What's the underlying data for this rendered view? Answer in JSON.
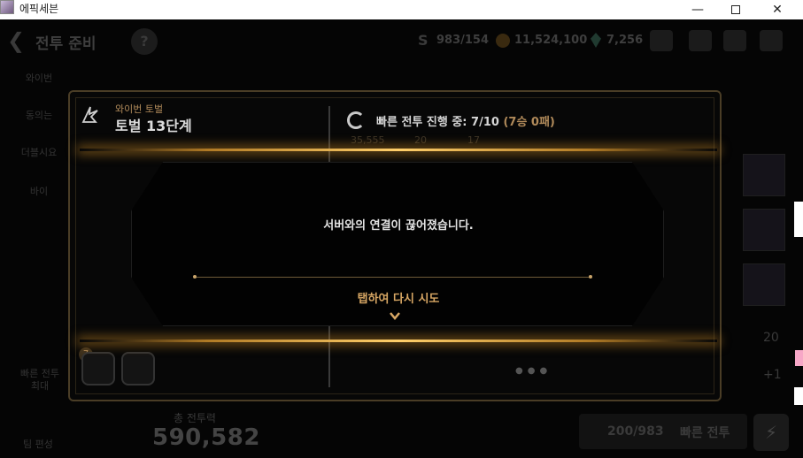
{
  "window": {
    "title": "에픽세븐",
    "minimize": "—",
    "close": "✕"
  },
  "header": {
    "back_icon": "chevron-left-icon",
    "title": "전투 준비",
    "help_label": "?",
    "energy": "983",
    "energy_max": "/154",
    "gold": "11,524,100",
    "gems": "7,256",
    "energy_symbol": "S"
  },
  "sidebar": {
    "items": [
      "와이번",
      "동의는",
      "더블시요",
      "바이"
    ],
    "quick_label": "빠른 전투 최대",
    "auto_label": "팀 편성"
  },
  "panel": {
    "stage_category": "와이번 토벌",
    "stage_name": "토벌 13단계",
    "progress_label": "빠른 전투 진행 중: 7/10",
    "progress_record": "(7승 0패)",
    "faded_values": [
      "35,555",
      "20",
      "17"
    ],
    "party_badge": "7"
  },
  "dialog": {
    "message": "서버와의 연결이 끊어졌습니다.",
    "retry_label": "탭하여 다시 시도"
  },
  "footer": {
    "power_label": "총 전투력",
    "power_value": "590,582",
    "quick_cost": "200/983",
    "quick_battle_label": "빠른 전투"
  },
  "right_column": {
    "count": "20",
    "plus": "+1"
  },
  "colors": {
    "accent_gold": "#d8a764",
    "glow": "#ffcf6a",
    "frame": "#4a3d26"
  }
}
